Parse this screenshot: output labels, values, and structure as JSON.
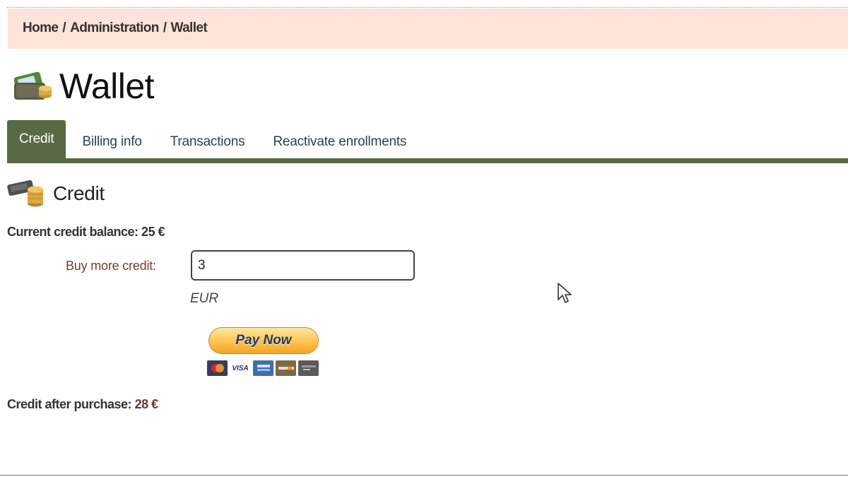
{
  "breadcrumb": {
    "items": [
      "Home",
      "Administration",
      "Wallet"
    ],
    "separator": "/"
  },
  "page": {
    "title": "Wallet",
    "icon": "wallet-icon"
  },
  "tabs": [
    {
      "label": "Credit",
      "active": true
    },
    {
      "label": "Billing info",
      "active": false
    },
    {
      "label": "Transactions",
      "active": false
    },
    {
      "label": "Reactivate enrollments",
      "active": false
    }
  ],
  "section": {
    "title": "Credit",
    "icon": "credit-coins-icon"
  },
  "balance": {
    "text": "Current credit balance: 25 €"
  },
  "buy": {
    "label": "Buy more credit:",
    "value": "3",
    "currency": "EUR"
  },
  "pay_button": {
    "label": "Pay Now"
  },
  "card_icons": [
    "mastercard-icon",
    "visa-icon",
    "amex-icon",
    "discover-icon",
    "bank-card-icon"
  ],
  "card_labels": {
    "visa": "VISA"
  },
  "after_purchase": {
    "label": "Credit after purchase:",
    "amount": "28 €"
  },
  "colors": {
    "breadcrumb_bg": "#fde3da",
    "tab_active_bg": "#596943",
    "tab_text": "#2f3f52",
    "label_accent": "#7a3b2e"
  }
}
